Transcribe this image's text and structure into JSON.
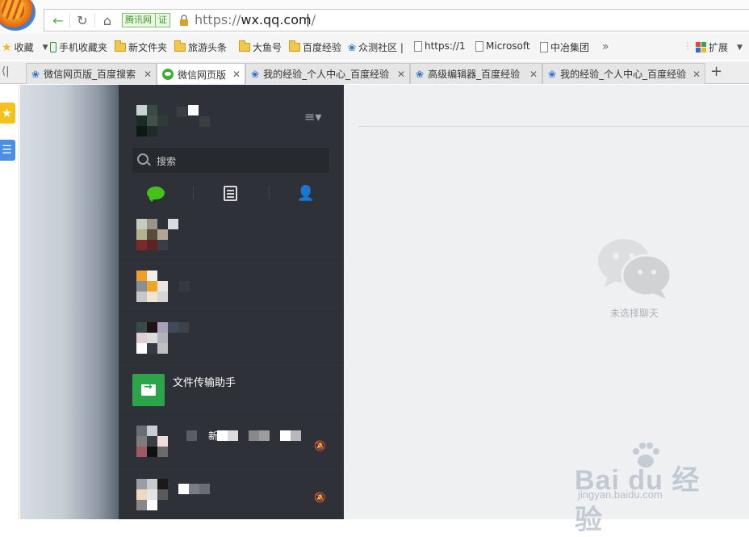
{
  "browser": {
    "cert_label": "腾讯网",
    "cert_badge": "证",
    "url_scheme": "https://",
    "url_host": "wx.qq.com",
    "url_path": "/"
  },
  "bookmarks": [
    {
      "label": "收藏",
      "icon": "star-icon"
    },
    {
      "label": "手机收藏夹",
      "icon": "phone-icon"
    },
    {
      "label": "新文件夹",
      "icon": "folder-icon"
    },
    {
      "label": "旅游头条",
      "icon": "folder-icon"
    },
    {
      "label": "大鱼号",
      "icon": "folder-icon"
    },
    {
      "label": "百度经验",
      "icon": "folder-icon"
    },
    {
      "label": "众测社区 |",
      "icon": "baidu-paw-icon"
    },
    {
      "label": "https://1",
      "icon": "page-icon"
    },
    {
      "label": "Microsoft",
      "icon": "page-icon"
    },
    {
      "label": "中冶集团",
      "icon": "page-icon"
    },
    {
      "label": "扩展",
      "icon": "extension-icon"
    }
  ],
  "tabs": [
    {
      "label": "微信网页版_百度搜索",
      "icon": "baidu-paw-icon",
      "active": false
    },
    {
      "label": "微信网页版",
      "icon": "wechat-icon",
      "active": true
    },
    {
      "label": "我的经验_个人中心_百度经验",
      "icon": "baidu-paw-icon",
      "active": false
    },
    {
      "label": "高级编辑器_百度经验",
      "icon": "baidu-paw-icon",
      "active": false
    },
    {
      "label": "我的经验_个人中心_百度经验",
      "icon": "baidu-paw-icon",
      "active": false
    }
  ],
  "wechat": {
    "search_placeholder": "搜索",
    "chats": [
      {
        "name": ""
      },
      {
        "name": ""
      },
      {
        "name": ""
      },
      {
        "name": "文件传输助手"
      },
      {
        "name": "新"
      },
      {
        "name": ""
      }
    ],
    "empty_state": "未选择聊天"
  },
  "watermark": {
    "brand": "Bai du 经验",
    "url": "jingyan.baidu.com"
  },
  "colors": {
    "wechat_sidebar": "#2e3238",
    "wechat_green": "#46c11b",
    "file_helper": "#2da44a",
    "main_bg": "#eef0f2"
  }
}
